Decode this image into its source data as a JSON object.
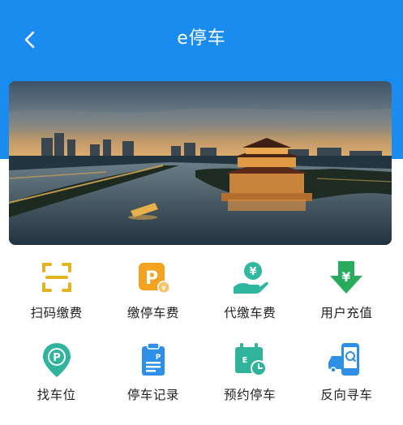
{
  "header": {
    "title": "e停车",
    "back_icon": "chevron-left-icon"
  },
  "banner": {
    "image": "city-river-night-skyline-with-pagoda",
    "active_page_color": "#2ebd3c"
  },
  "services": [
    {
      "label": "扫码缴费",
      "icon": "scan-code-icon",
      "color": "#e3b322"
    },
    {
      "label": "缴停车费",
      "icon": "parking-payment-icon",
      "color": "#f3a31f"
    },
    {
      "label": "代缴车费",
      "icon": "yuan-hand-icon",
      "color": "#2fb7a0"
    },
    {
      "label": "用户充值",
      "icon": "recharge-arrow-icon",
      "color": "#29ab5d"
    },
    {
      "label": "找车位",
      "icon": "parking-location-icon",
      "color": "#30b49d"
    },
    {
      "label": "停车记录",
      "icon": "parking-record-icon",
      "color": "#2d8fe6"
    },
    {
      "label": "预约停车",
      "icon": "reserve-calendar-icon",
      "color": "#2fb39b"
    },
    {
      "label": "反向寻车",
      "icon": "find-car-icon",
      "color": "#2d8fe6"
    }
  ],
  "colors": {
    "header_bg": "#1a8cf0",
    "text": "#222222"
  }
}
